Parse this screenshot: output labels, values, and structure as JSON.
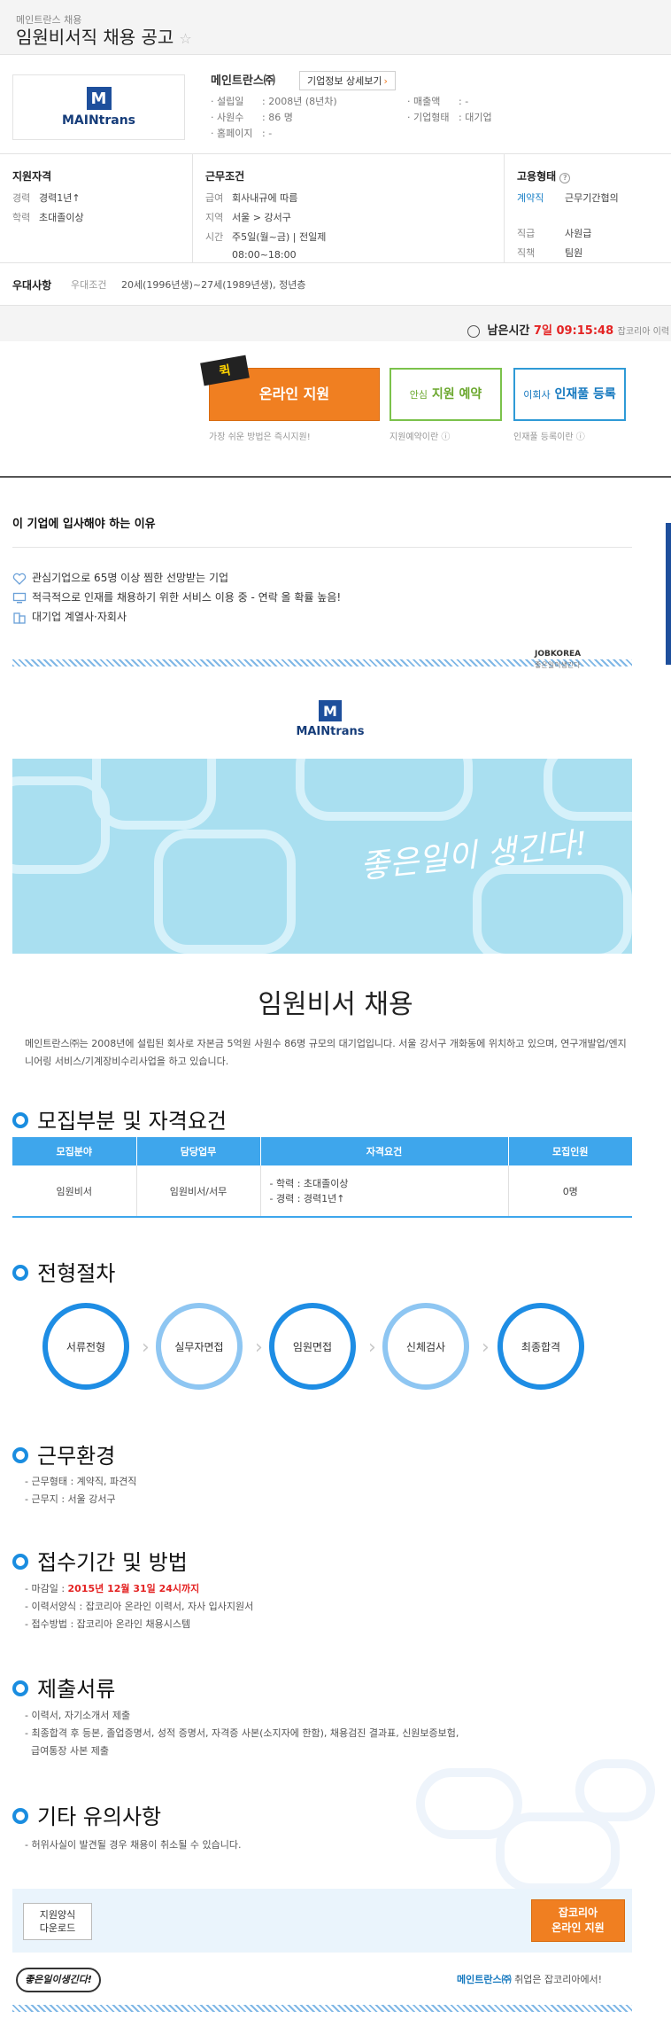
{
  "header": {
    "breadcrumb": "메인트란스 채용",
    "title": "임원비서직 채용 공고"
  },
  "company": {
    "logo_text": "MAINtrans",
    "logo_letter": "M",
    "name": "메인트란스㈜",
    "detail_button": "기업정보 상세보기",
    "fields": [
      {
        "label": "· 설립일",
        "value": ": 2008년 (8년차)"
      },
      {
        "label": "· 사원수",
        "value": ": 86 명"
      },
      {
        "label": "· 홈페이지",
        "value": ": -"
      },
      {
        "label": "· 매출액",
        "value": ": -"
      },
      {
        "label": "· 기업형태",
        "value": ": 대기업"
      }
    ]
  },
  "conditions": {
    "qualification": {
      "title": "지원자격",
      "rows": [
        {
          "k": "경력",
          "v": "경력1년↑"
        },
        {
          "k": "학력",
          "v": "초대졸이상"
        }
      ]
    },
    "work": {
      "title": "근무조건",
      "rows": [
        {
          "k": "급여",
          "v": "회사내규에 따름"
        },
        {
          "k": "지역",
          "v": "서울 > 강서구"
        },
        {
          "k": "시간",
          "v": "주5일(월~금) | 전일제"
        },
        {
          "k": "",
          "v": "08:00~18:00"
        }
      ]
    },
    "employment": {
      "title": "고용형태",
      "rows": [
        {
          "k": "계약직",
          "v": "근무기간협의"
        },
        {
          "k": "직급",
          "v": "사원급"
        },
        {
          "k": "직책",
          "v": "팀원"
        }
      ]
    },
    "benefit": {
      "title": "우대사항",
      "sub": "우대조건",
      "value": "20세(1996년생)~27세(1989년생), 정년층"
    }
  },
  "deadline": {
    "label": "남은시간",
    "days": "7일",
    "time": "09:15:48",
    "suffix": "잡코리아 이력"
  },
  "apply": {
    "badge": "퀵",
    "online": "온라인 지원",
    "online_hint": "가장 쉬운 방법은 즉시지원!",
    "reserve_small": "안심",
    "reserve": "지원 예약",
    "reserve_hint": "지원예약이란",
    "register_small": "이회사",
    "register": "인재풀 등록",
    "register_hint": "인재풀 등록이란"
  },
  "reasons": {
    "title": "이 기업에 입사해야 하는 이유",
    "items": [
      "관심기업으로 65명 이상 찜한 선망받는 기업",
      "적극적으로 인재를 채용하기 위한 서비스 이용 중 - 연락 올 확률 높음!",
      "대기업 계열사·자회사"
    ]
  },
  "jobkorea": {
    "name": "JOBKOREA",
    "sub": "좋은일이생긴다"
  },
  "banner": {
    "slogan": "좋은일이 생긴다!"
  },
  "job": {
    "title": "임원비서 채용",
    "intro": "메인트란스㈜는 2008년에 설립된 회사로 자본금 5억원 사원수 86명 규모의 대기업입니다. 서울 강서구 개화동에 위치하고 있으며, 연구개발업/엔지니어링 서비스/기계장비수리사업을 하고 있습니다."
  },
  "sections": {
    "recruit": {
      "title": "모집부분 및 자격요건",
      "headers": [
        "모집분야",
        "담당업무",
        "자격요건",
        "모집인원"
      ],
      "row": {
        "field": "임원비서",
        "duty": "임원비서/서무",
        "req1": "- 학력 : 초대졸이상",
        "req2": "- 경력 : 경력1년↑",
        "count": "0명"
      }
    },
    "process": {
      "title": "전형절차",
      "steps": [
        "서류전형",
        "실무자면접",
        "임원면접",
        "신체검사",
        "최종합격"
      ]
    },
    "env": {
      "title": "근무환경",
      "items": [
        "- 근무형태 : 계약직, 파견직",
        "- 근무지 : 서울 강서구"
      ]
    },
    "period": {
      "title": "접수기간 및 방법",
      "deadline_label": "- 마감일 :",
      "deadline_value": "2015년 12월 31일 24시까지",
      "items": [
        "- 이력서양식 : 잡코리아 온라인 이력서, 자사 입사지원서",
        "- 접수방법 : 잡코리아 온라인 채용시스템"
      ]
    },
    "docs": {
      "title": "제출서류",
      "items": [
        "- 이력서, 자기소개서 제출",
        "- 최종합격 후 등본, 졸업증명서, 성적 증명서, 자격증 사본(소지자에 한함), 채용검진 결과표, 신원보증보험,",
        "  급여통장 사본 제출"
      ]
    },
    "etc": {
      "title": "기타 유의사항",
      "items": [
        "- 허위사실이 발견될 경우 채용이 취소될 수 있습니다."
      ]
    }
  },
  "bottom": {
    "download": "지원양식\n다운로드",
    "download1": "지원양식",
    "download2": "다운로드",
    "apply1": "잡코리아",
    "apply2": "온라인 지원"
  },
  "footer": {
    "logo": "좋은일이생긴다!",
    "company": "메인트란스㈜",
    "text": " 취업은 잡코리아에서!"
  },
  "colors": {
    "accent": "#1a8de0",
    "orange": "#f07f21",
    "red": "#e42323"
  }
}
